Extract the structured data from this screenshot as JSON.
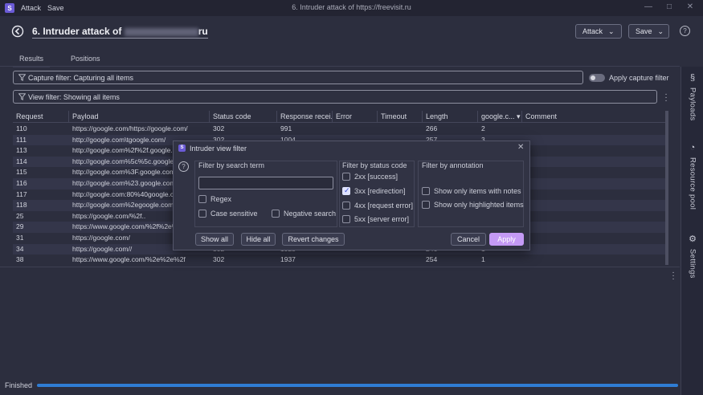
{
  "titlebar": {
    "menu": [
      "Attack",
      "Save"
    ],
    "window_title": "6. Intruder attack of https://freevisit.ru",
    "controls": {
      "minimize": "—",
      "maximize": "□",
      "close": "✕"
    }
  },
  "header": {
    "title_prefix": "6. Intruder attack of",
    "title_suffix": "ru",
    "attack_label": "Attack",
    "save_label": "Save",
    "chevron": "⌄",
    "help": "?"
  },
  "tabs": [
    {
      "label": "Results",
      "active": true
    },
    {
      "label": "Positions",
      "active": false
    }
  ],
  "filters": {
    "capture": "Capture filter: Capturing all items",
    "view": "View filter: Showing all items",
    "apply_capture_label": "Apply capture filter",
    "apply_capture_on": false
  },
  "table": {
    "columns": [
      "Request",
      "Payload",
      "Status code",
      "Response recei...",
      "Error",
      "Timeout",
      "Length",
      "google.c...",
      "Comment"
    ],
    "sort_indicator": "▾",
    "rows": [
      [
        "110",
        "https://google.com/https://google.com/",
        "302",
        "991",
        "",
        "",
        "266",
        "2",
        ""
      ],
      [
        "111",
        "http://google.com\\tgoogle.com/",
        "302",
        "1004",
        "",
        "",
        "257",
        "3",
        ""
      ],
      [
        "113",
        "http://google.com%2f%2f.google.com/",
        "302",
        "998",
        "",
        "",
        "",
        "",
        ""
      ],
      [
        "114",
        "http://google.com%5c%5c.google.com/",
        "",
        "",
        "",
        "",
        "",
        "",
        ""
      ],
      [
        "115",
        "http://google.com%3F.google.com/",
        "",
        "",
        "",
        "",
        "",
        "",
        ""
      ],
      [
        "116",
        "http://google.com%23.google.com/",
        "",
        "",
        "",
        "",
        "",
        "",
        ""
      ],
      [
        "117",
        "http://google.com:80%40google.com/",
        "",
        "",
        "",
        "",
        "",
        "",
        ""
      ],
      [
        "118",
        "http://google.com%2egoogle.com/",
        "",
        "",
        "",
        "",
        "",
        "",
        ""
      ],
      [
        "25",
        "https://google.com/%2f..",
        "",
        "",
        "",
        "",
        "",
        "",
        ""
      ],
      [
        "29",
        "https://www.google.com/%2f%2e%2e",
        "",
        "",
        "",
        "",
        "",
        "",
        ""
      ],
      [
        "31",
        "https://google.com/",
        "",
        "",
        "",
        "",
        "",
        "",
        ""
      ],
      [
        "34",
        "https://google.com//",
        "302",
        "1925",
        "",
        "",
        "246",
        "1",
        ""
      ],
      [
        "38",
        "https://www.google.com/%2e%2e%2f",
        "302",
        "1937",
        "",
        "",
        "254",
        "1",
        ""
      ]
    ]
  },
  "sidebar": [
    {
      "icon": "§",
      "label": "Payloads"
    },
    {
      "icon": "◔",
      "label": "Resource pool"
    },
    {
      "icon": "⚙",
      "label": "Settings"
    }
  ],
  "status": {
    "text": "Finished",
    "progress": 1.0
  },
  "dialog": {
    "title": "Intruder view filter",
    "close": "✕",
    "help": "?",
    "search": {
      "title": "Filter by search term",
      "value": "",
      "regex": {
        "label": "Regex",
        "checked": false
      },
      "case_sensitive": {
        "label": "Case sensitive",
        "checked": false
      },
      "negative_search": {
        "label": "Negative search",
        "checked": false
      }
    },
    "status_code": {
      "title": "Filter by status code",
      "options": [
        {
          "label": "2xx  [success]",
          "checked": false
        },
        {
          "label": "3xx  [redirection]",
          "checked": true
        },
        {
          "label": "4xx  [request error]",
          "checked": false
        },
        {
          "label": "5xx  [server error]",
          "checked": false
        }
      ]
    },
    "annotation": {
      "title": "Filter by annotation",
      "options": [
        {
          "label": "Show only items with notes",
          "checked": false
        },
        {
          "label": "Show only highlighted items",
          "checked": false
        }
      ]
    },
    "buttons": {
      "show_all": "Show all",
      "hide_all": "Hide all",
      "revert": "Revert changes",
      "cancel": "Cancel",
      "apply": "Apply"
    }
  }
}
